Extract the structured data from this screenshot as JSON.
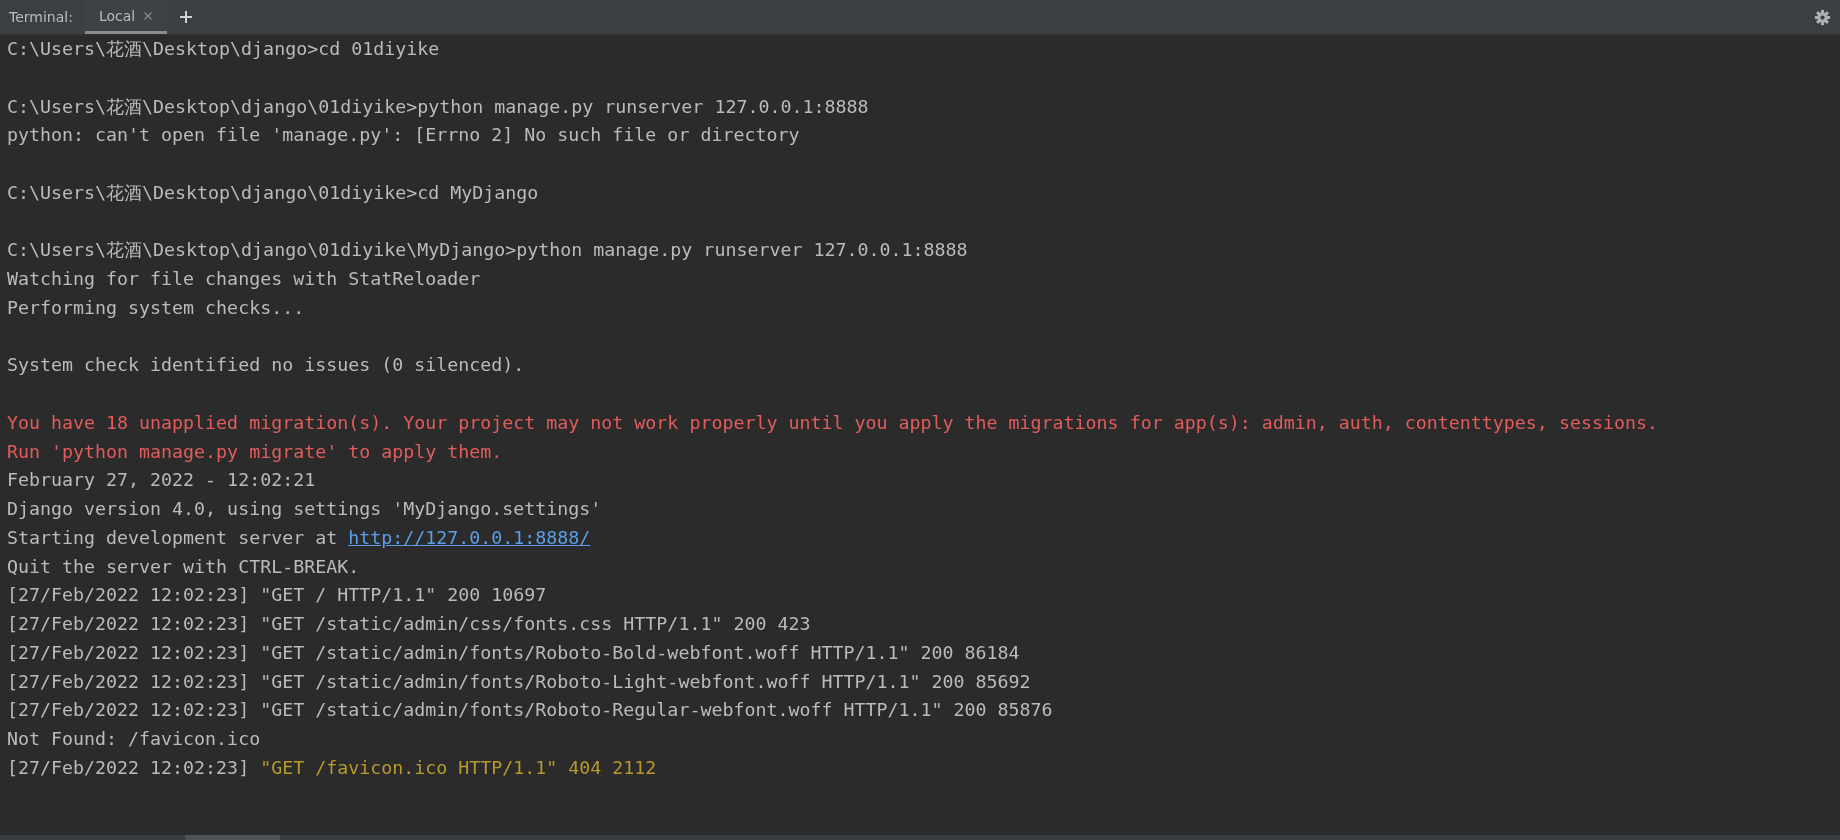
{
  "toolbar": {
    "title": "Terminal:",
    "tabs": [
      {
        "label": "Local",
        "selected": true
      }
    ]
  },
  "lines": [
    {
      "blank_line_before": false,
      "segments": [
        {
          "text": "C:\\Users\\花酒\\Desktop\\django>cd 01diyike",
          "kind": "normal"
        }
      ]
    },
    {
      "blank_line_before": true,
      "segments": [
        {
          "text": "C:\\Users\\花酒\\Desktop\\django\\01diyike>python manage.py runserver 127.0.0.1:8888",
          "kind": "normal"
        }
      ]
    },
    {
      "blank_line_before": false,
      "segments": [
        {
          "text": "python: can't open file 'manage.py': [Errno 2] No such file or directory",
          "kind": "normal"
        }
      ]
    },
    {
      "blank_line_before": true,
      "segments": [
        {
          "text": "C:\\Users\\花酒\\Desktop\\django\\01diyike>cd MyDjango",
          "kind": "normal"
        }
      ]
    },
    {
      "blank_line_before": true,
      "segments": [
        {
          "text": "C:\\Users\\花酒\\Desktop\\django\\01diyike\\MyDjango>python manage.py runserver 127.0.0.1:8888",
          "kind": "normal"
        }
      ]
    },
    {
      "blank_line_before": false,
      "segments": [
        {
          "text": "Watching for file changes with StatReloader",
          "kind": "normal"
        }
      ]
    },
    {
      "blank_line_before": false,
      "segments": [
        {
          "text": "Performing system checks...",
          "kind": "normal"
        }
      ]
    },
    {
      "blank_line_before": true,
      "segments": [
        {
          "text": "System check identified no issues (0 silenced).",
          "kind": "normal"
        }
      ]
    },
    {
      "blank_line_before": true,
      "segments": [
        {
          "text": "You have 18 unapplied migration(s). Your project may not work properly until you apply the migrations for app(s): admin, auth, contenttypes, sessions.",
          "kind": "error"
        }
      ]
    },
    {
      "blank_line_before": false,
      "segments": [
        {
          "text": "Run 'python manage.py migrate' to apply them.",
          "kind": "error"
        }
      ]
    },
    {
      "blank_line_before": false,
      "segments": [
        {
          "text": "February 27, 2022 - 12:02:21",
          "kind": "normal"
        }
      ]
    },
    {
      "blank_line_before": false,
      "segments": [
        {
          "text": "Django version 4.0, using settings 'MyDjango.settings'",
          "kind": "normal"
        }
      ]
    },
    {
      "blank_line_before": false,
      "segments": [
        {
          "text": "Starting development server at ",
          "kind": "normal"
        },
        {
          "text": "http://127.0.0.1:8888/",
          "kind": "link"
        }
      ]
    },
    {
      "blank_line_before": false,
      "segments": [
        {
          "text": "Quit the server with CTRL-BREAK.",
          "kind": "normal"
        }
      ]
    },
    {
      "blank_line_before": false,
      "segments": [
        {
          "text": "[27/Feb/2022 12:02:23] \"GET / HTTP/1.1\" 200 10697",
          "kind": "normal"
        }
      ]
    },
    {
      "blank_line_before": false,
      "segments": [
        {
          "text": "[27/Feb/2022 12:02:23] \"GET /static/admin/css/fonts.css HTTP/1.1\" 200 423",
          "kind": "normal"
        }
      ]
    },
    {
      "blank_line_before": false,
      "segments": [
        {
          "text": "[27/Feb/2022 12:02:23] \"GET /static/admin/fonts/Roboto-Bold-webfont.woff HTTP/1.1\" 200 86184",
          "kind": "normal"
        }
      ]
    },
    {
      "blank_line_before": false,
      "segments": [
        {
          "text": "[27/Feb/2022 12:02:23] \"GET /static/admin/fonts/Roboto-Light-webfont.woff HTTP/1.1\" 200 85692",
          "kind": "normal"
        }
      ]
    },
    {
      "blank_line_before": false,
      "segments": [
        {
          "text": "[27/Feb/2022 12:02:23] \"GET /static/admin/fonts/Roboto-Regular-webfont.woff HTTP/1.1\" 200 85876",
          "kind": "normal"
        }
      ]
    },
    {
      "blank_line_before": false,
      "segments": [
        {
          "text": "Not Found: /favicon.ico",
          "kind": "normal"
        }
      ]
    },
    {
      "blank_line_before": false,
      "segments": [
        {
          "text": "[27/Feb/2022 12:02:23] ",
          "kind": "normal"
        },
        {
          "text": "\"GET /favicon.ico HTTP/1.1\" 404 2112",
          "kind": "warning"
        }
      ]
    }
  ]
}
